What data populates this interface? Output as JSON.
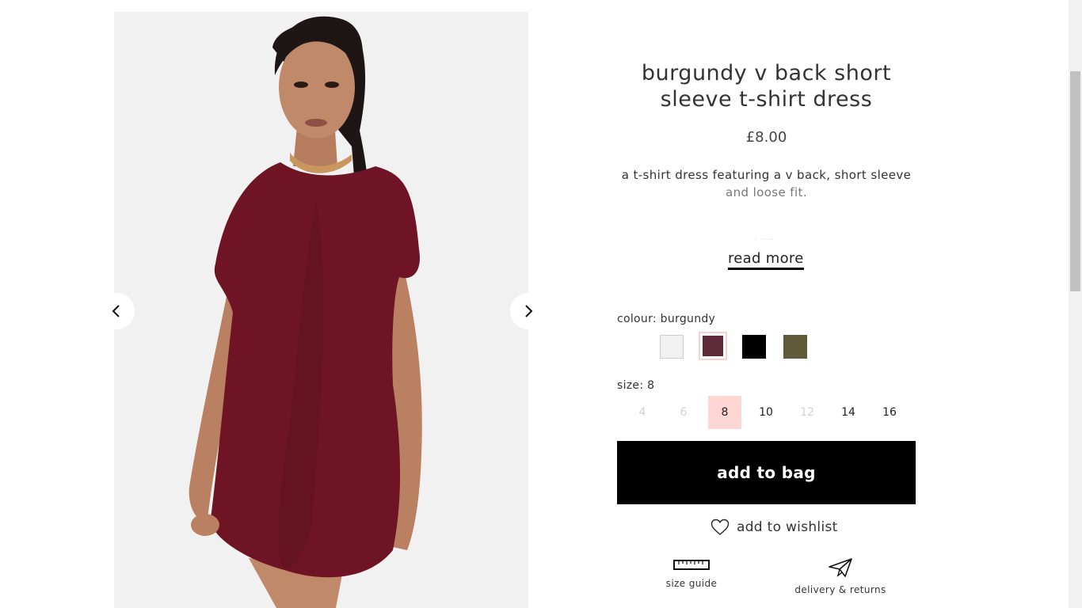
{
  "product": {
    "title": "burgundy v back short sleeve t-shirt dress",
    "price": "£8.00",
    "description_line1": "a t-shirt dress featuring a v back, short sleeve",
    "description_line2": "and loose fit.",
    "read_more": "read more"
  },
  "gallery": {
    "image_desc": "model wearing burgundy short sleeve t-shirt dress",
    "prev_icon": "chevron-left-icon",
    "next_icon": "chevron-right-icon"
  },
  "colour": {
    "label": "colour: burgundy",
    "swatches": [
      {
        "name": "white",
        "color": "#f1f1f1"
      },
      {
        "name": "burgundy",
        "color": "#5e2939",
        "selected": true
      },
      {
        "name": "black",
        "color": "#000000"
      },
      {
        "name": "khaki",
        "color": "#605a3a"
      }
    ]
  },
  "size": {
    "label": "size: 8",
    "options": [
      {
        "value": "4",
        "available": false
      },
      {
        "value": "6",
        "available": false
      },
      {
        "value": "8",
        "available": true,
        "selected": true
      },
      {
        "value": "10",
        "available": true
      },
      {
        "value": "12",
        "available": false
      },
      {
        "value": "14",
        "available": true
      },
      {
        "value": "16",
        "available": true
      }
    ]
  },
  "actions": {
    "add_to_bag": "add to bag",
    "add_to_wishlist": "add to wishlist",
    "size_guide": "size guide",
    "delivery_returns": "delivery & returns"
  },
  "colors": {
    "accent_pink": "#fed7d5",
    "button_black": "#000000"
  }
}
